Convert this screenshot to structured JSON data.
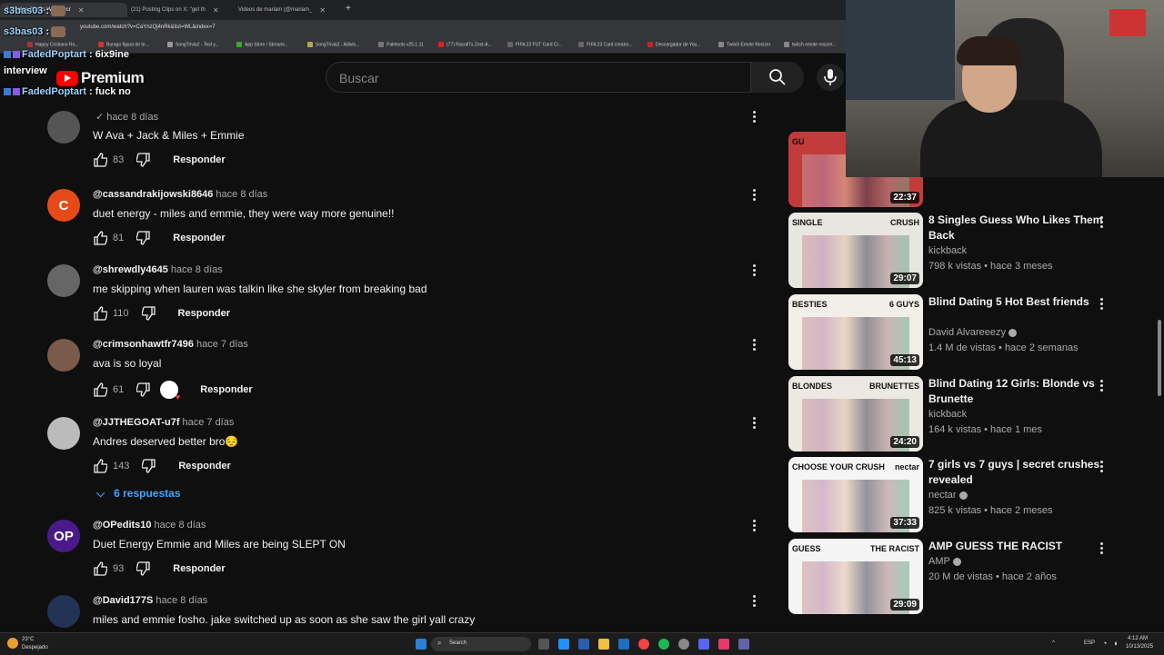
{
  "browser": {
    "tabs": [
      {
        "label": "8 Singles Guess Who Secr"
      },
      {
        "label": "(21) Posting Clips on X: \"get th"
      },
      {
        "label": "Videos de mariam (@mariam_"
      }
    ],
    "url": "youtube.com/watch?v=CaYnzQj4nRk&list=WL&index=7",
    "bookmarks": [
      "Happy Cristiano Ro...",
      "Burago figura de te...",
      "SongTrivia2 - Test y...",
      "App Store / Streami...",
      "SongTrivia2 - Adivin...",
      "Paletools v25.1.11",
      "(77) Racoll7s Zest-A...",
      "FIFA 23 FUT Card Cr...",
      "FIFA 23 Card creator...",
      "Descargador de You...",
      "Twitch Emote Resizer",
      "twitch emote resizer..."
    ]
  },
  "chat_overlay": [
    {
      "user": "s3bas03",
      "sep": ":",
      "msg": ""
    },
    {
      "user": "s3bas03",
      "sep": ":",
      "msg": ""
    },
    {
      "user": "FadedPoptart",
      "sep": ":",
      "msg": "6ix9ine"
    },
    {
      "user": "",
      "sep": "",
      "msg": "interview"
    },
    {
      "user": "FadedPoptart",
      "sep": ":",
      "msg": "fuck no"
    }
  ],
  "youtube": {
    "logo_text": "Premium",
    "search_placeholder": "Buscar"
  },
  "comments": [
    {
      "handle": "",
      "when": "hace 8 días",
      "text": "W Ava + Jack & Miles + Emmie",
      "likes": "83",
      "reply": "Responder",
      "avatar_color": "#555",
      "avatar_letter": ""
    },
    {
      "handle": "@cassandrakijowski8646",
      "when": "hace 8 días",
      "text": "duet energy - miles and emmie, they were way more genuine!!",
      "likes": "81",
      "reply": "Responder",
      "avatar_color": "#e64a19",
      "avatar_letter": "C"
    },
    {
      "handle": "@shrewdly4645",
      "when": "hace 8 días",
      "text": "me skipping when lauren was talkin like she skyler from breaking bad",
      "likes": "110",
      "reply": "Responder",
      "avatar_color": "#666",
      "avatar_letter": ""
    },
    {
      "handle": "@crimsonhawtfr7496",
      "when": "hace 7 días",
      "text": "ava is so loyal",
      "likes": "61",
      "reply": "Responder",
      "avatar_color": "#7a5a4a",
      "avatar_letter": ""
    },
    {
      "handle": "@JJTHEGOAT-u7f",
      "when": "hace 7 días",
      "text": "Andres deserved better bro😔",
      "likes": "143",
      "reply": "Responder",
      "avatar_color": "#bbb",
      "avatar_letter": ""
    },
    {
      "handle": "@OPedits10",
      "when": "hace 8 días",
      "text": "Duet Energy Emmie and Miles are being SLEPT ON",
      "likes": "93",
      "reply": "Responder",
      "avatar_color": "#4a1a8a",
      "avatar_letter": "OP"
    },
    {
      "handle": "@David177S",
      "when": "hace 8 días",
      "text": "miles and emmie fosho. jake switched up as soon as she saw the girl yall crazy",
      "likes": "",
      "reply": "",
      "avatar_color": "#223355",
      "avatar_letter": ""
    }
  ],
  "replies_toggle": "6 respuestas",
  "videos": [
    {
      "title": "",
      "channel": "",
      "meta": "",
      "duration": "22:37",
      "thumb_labels": [
        "GU",
        ""
      ],
      "thumb_color": "#c23b3b",
      "verified": false
    },
    {
      "title": "8 Singles Guess Who Likes Them Back",
      "channel": "kickback",
      "meta": "798 k vistas • hace 3 meses",
      "duration": "29:07",
      "thumb_labels": [
        "SINGLE",
        "CRUSH"
      ],
      "thumb_color": "#e8e6e0",
      "verified": false
    },
    {
      "title": "Blind Dating 5 Hot Best friends",
      "channel": "David Alvareeezy",
      "meta": "1.4 M de vistas • hace 2 semanas",
      "duration": "45:13",
      "thumb_labels": [
        "BESTIES",
        "6 GUYS"
      ],
      "thumb_color": "#f2efe8",
      "verified": true
    },
    {
      "title": "Blind Dating 12 Girls: Blonde vs Brunette",
      "channel": "kickback",
      "meta": "164 k vistas • hace 1 mes",
      "duration": "24:20",
      "thumb_labels": [
        "BLONDES",
        "BRUNETTES"
      ],
      "thumb_color": "#ece9e2",
      "verified": false
    },
    {
      "title": "7 girls vs 7 guys | secret crushes revealed",
      "channel": "nectar",
      "meta": "825 k vistas • hace 2 meses",
      "duration": "37:33",
      "thumb_labels": [
        "CHOOSE YOUR CRUSH",
        "nectar"
      ],
      "thumb_color": "#f5f5f5",
      "verified": true
    },
    {
      "title": "AMP GUESS THE RACIST",
      "channel": "AMP",
      "meta": "20 M de vistas • hace 2 años",
      "duration": "29:09",
      "thumb_labels": [
        "GUESS",
        "THE RACIST"
      ],
      "thumb_color": "#f4f4f4",
      "verified": true
    }
  ],
  "taskbar": {
    "weather_temp": "23°C",
    "weather_text": "Despejado",
    "search_label": "Search",
    "lang": "ESP",
    "time": "4:12 AM",
    "date": "10/13/2025"
  },
  "colors": {
    "accent_link": "#3ea6ff",
    "yt_red": "#ff0000",
    "bg": "#0f0f0f"
  }
}
